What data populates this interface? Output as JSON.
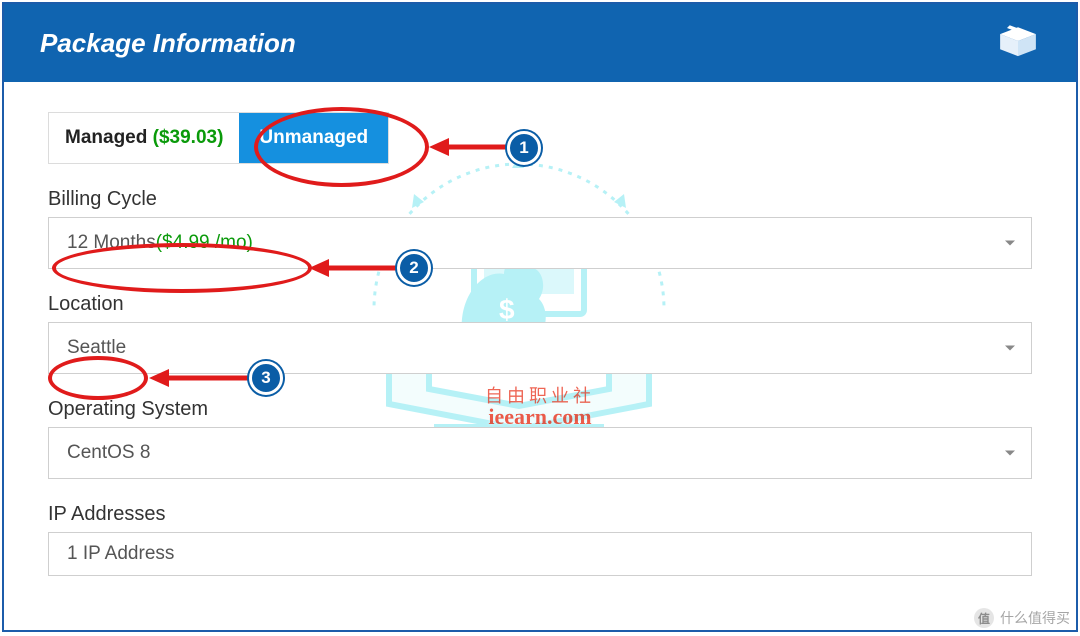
{
  "header": {
    "title": "Package Information"
  },
  "toggle": {
    "managed_label": "Managed",
    "managed_price": "($39.03)",
    "unmanaged_label": "Unmanaged"
  },
  "billing": {
    "label": "Billing Cycle",
    "value_prefix": "12 Months ",
    "value_price": "($4.99 /mo)"
  },
  "location": {
    "label": "Location",
    "value": "Seattle"
  },
  "os": {
    "label": "Operating System",
    "value": "CentOS 8"
  },
  "ip": {
    "label": "IP Addresses",
    "value": "1 IP Address"
  },
  "annotations": {
    "badge1": "1",
    "badge2": "2",
    "badge3": "3"
  },
  "watermark": {
    "line1": "自由职业社",
    "line2": "ieearn.com",
    "corner": "什么值得买"
  }
}
